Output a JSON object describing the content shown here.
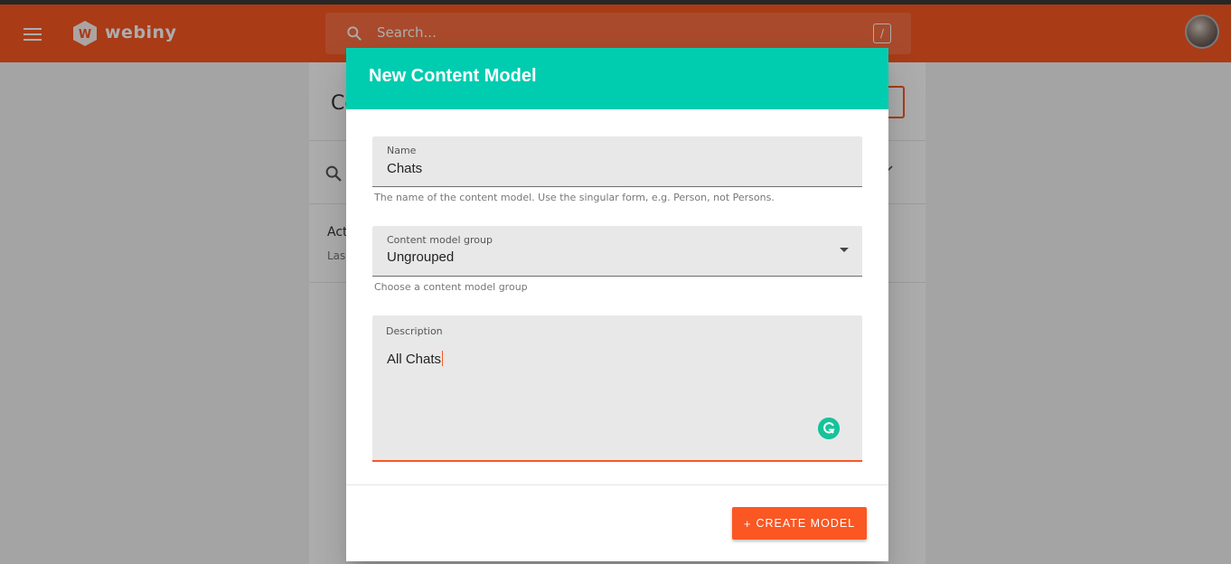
{
  "app": {
    "brand": "webiny",
    "search_placeholder": "Search...",
    "search_shortcut": "/"
  },
  "background": {
    "page_title_partial": "Co",
    "list_item_title_partial": "Act",
    "list_item_subtitle_partial": "Las"
  },
  "dialog": {
    "title": "New Content Model",
    "name_field": {
      "label": "Name",
      "value": "Chats",
      "helper": "The name of the content model. Use the singular form, e.g. Person, not Persons."
    },
    "group_field": {
      "label": "Content model group",
      "value": "Ungrouped",
      "helper": "Choose a content model group"
    },
    "description_field": {
      "label": "Description",
      "value": "All Chats"
    },
    "create_button": {
      "icon": "+",
      "label": "CREATE MODEL"
    }
  },
  "colors": {
    "brand_orange": "#fa5723",
    "dialog_header": "#00ccb0",
    "grammarly": "#15c39a"
  },
  "icons": {
    "menu": "hamburger-icon",
    "logo": "webiny-logo-icon",
    "search": "search-icon",
    "avatar": "user-avatar",
    "dropdown": "dropdown-arrow-icon",
    "grammarly": "grammarly-icon"
  }
}
